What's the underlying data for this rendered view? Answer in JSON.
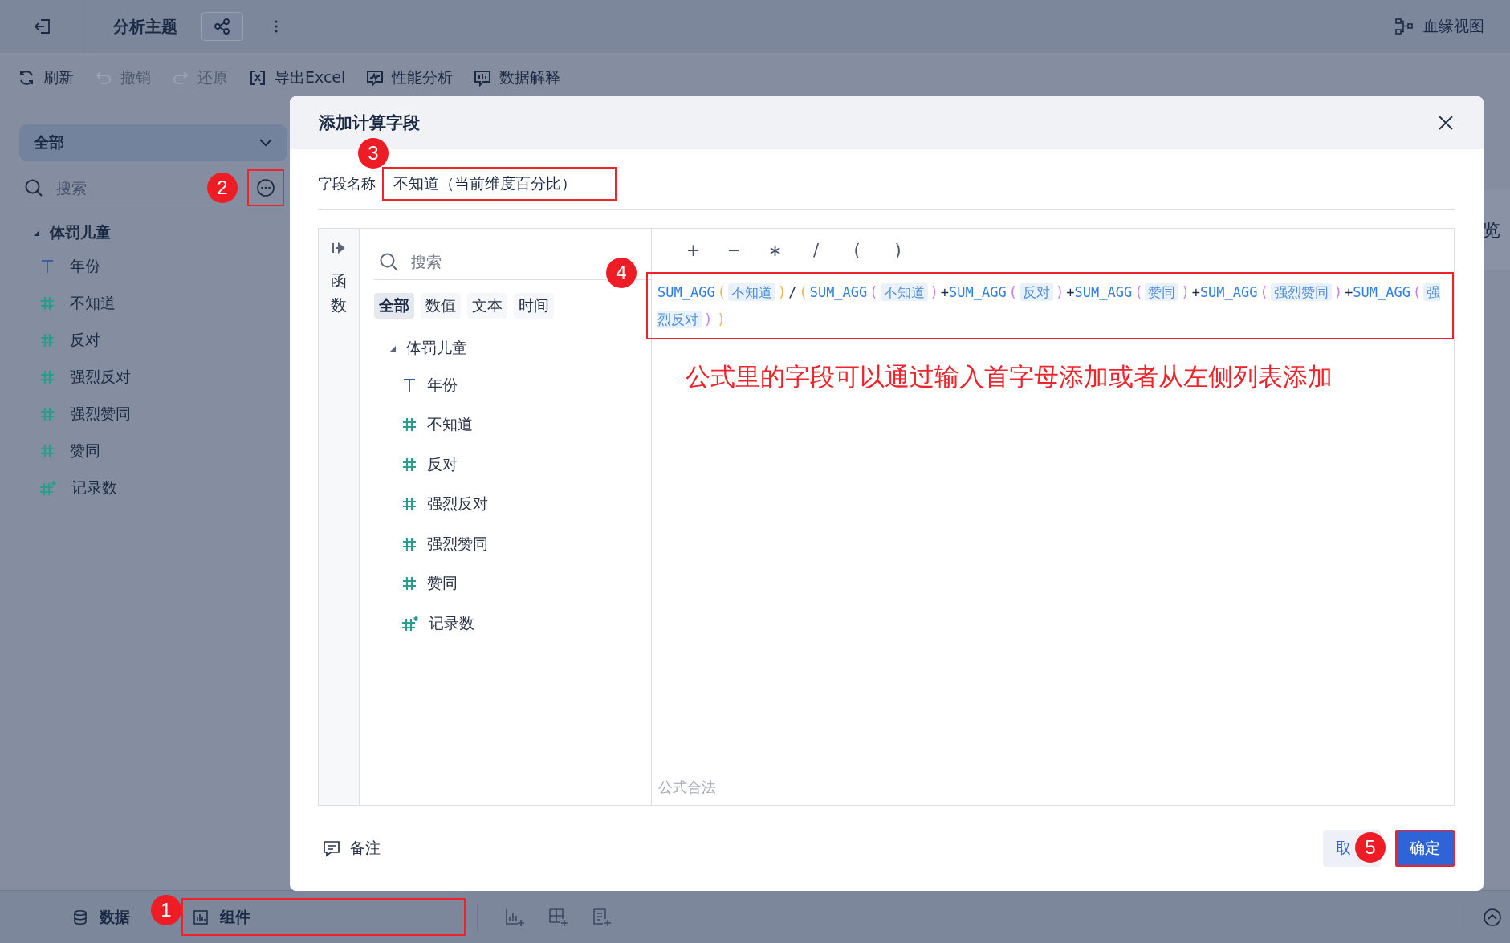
{
  "top_bar": {
    "title": "分析主题",
    "lineage_link": "血缘视图"
  },
  "toolbar": [
    {
      "kind": "refresh",
      "label": "刷新",
      "disabled": false
    },
    {
      "kind": "undo",
      "label": "撤销",
      "disabled": true
    },
    {
      "kind": "redo",
      "label": "还原",
      "disabled": true
    },
    {
      "kind": "excel",
      "label": "导出Excel",
      "disabled": false
    },
    {
      "kind": "performance",
      "label": "性能分析",
      "disabled": false
    },
    {
      "kind": "explain",
      "label": "数据解释",
      "disabled": false
    }
  ],
  "sidebar": {
    "scope_select": "全部",
    "search": {
      "placeholder": "搜索"
    },
    "more_button": {
      "highlighted": true,
      "badge": "2"
    },
    "tree": [
      {
        "label": "体罚儿童",
        "expanded": true,
        "children": [
          {
            "label": "年份",
            "kind": "text"
          },
          {
            "label": "不知道",
            "kind": "number"
          },
          {
            "label": "反对",
            "kind": "number"
          },
          {
            "label": "强烈反对",
            "kind": "number"
          },
          {
            "label": "强烈赞同",
            "kind": "number"
          },
          {
            "label": "赞同",
            "kind": "number"
          },
          {
            "label": "记录数",
            "kind": "count"
          }
        ]
      }
    ]
  },
  "background_panel": {
    "text": "览"
  },
  "dialog": {
    "title": "添加计算字段",
    "name_field": {
      "label": "字段名称",
      "value": "不知道（当前维度百分比）",
      "highlighted": true,
      "badge": "3"
    },
    "side_tab": "函数",
    "field_search": {
      "placeholder": "搜索"
    },
    "filters": [
      {
        "label": "全部",
        "selected": true
      },
      {
        "label": "数值",
        "selected": false
      },
      {
        "label": "文本",
        "selected": false
      },
      {
        "label": "时间",
        "selected": false
      }
    ],
    "field_tree": [
      {
        "label": "体罚儿童",
        "expanded": true,
        "children": [
          {
            "label": "年份",
            "kind": "text"
          },
          {
            "label": "不知道",
            "kind": "number"
          },
          {
            "label": "反对",
            "kind": "number"
          },
          {
            "label": "强烈反对",
            "kind": "number"
          },
          {
            "label": "强烈赞同",
            "kind": "number"
          },
          {
            "label": "赞同",
            "kind": "number"
          },
          {
            "label": "记录数",
            "kind": "count"
          }
        ]
      }
    ],
    "operators": [
      "+",
      "−",
      "∗",
      "/",
      "(",
      ")"
    ],
    "formula": {
      "highlighted": true,
      "badge": "4",
      "tokens": [
        {
          "kind": "func",
          "text": "SUM_AGG"
        },
        {
          "kind": "paren",
          "text": "(",
          "color": "#e8b54c"
        },
        {
          "kind": "field",
          "text": "不知道"
        },
        {
          "kind": "paren",
          "text": ")",
          "color": "#e8b54c"
        },
        {
          "kind": "op",
          "text": "/"
        },
        {
          "kind": "paren",
          "text": "(",
          "color": "#e8b54c"
        },
        {
          "kind": "func",
          "text": "SUM_AGG"
        },
        {
          "kind": "paren",
          "text": "(",
          "color": "#c77ee3"
        },
        {
          "kind": "field",
          "text": "不知道"
        },
        {
          "kind": "paren",
          "text": ")",
          "color": "#c77ee3"
        },
        {
          "kind": "op",
          "text": "+"
        },
        {
          "kind": "func",
          "text": "SUM_AGG"
        },
        {
          "kind": "paren",
          "text": "(",
          "color": "#c77ee3"
        },
        {
          "kind": "field",
          "text": "反对"
        },
        {
          "kind": "paren",
          "text": ")",
          "color": "#c77ee3"
        },
        {
          "kind": "op",
          "text": "+"
        },
        {
          "kind": "func",
          "text": "SUM_AGG"
        },
        {
          "kind": "paren",
          "text": "(",
          "color": "#c77ee3"
        },
        {
          "kind": "field",
          "text": "赞同"
        },
        {
          "kind": "paren",
          "text": ")",
          "color": "#c77ee3"
        },
        {
          "kind": "op",
          "text": "+"
        },
        {
          "kind": "func",
          "text": "SUM_AGG"
        },
        {
          "kind": "paren",
          "text": "(",
          "color": "#c77ee3"
        },
        {
          "kind": "field",
          "text": "强烈赞同"
        },
        {
          "kind": "paren",
          "text": ")",
          "color": "#c77ee3"
        },
        {
          "kind": "op",
          "text": "+"
        },
        {
          "kind": "func",
          "text": "SUM_AGG"
        },
        {
          "kind": "paren",
          "text": "(",
          "color": "#c77ee3"
        },
        {
          "kind": "field",
          "text": "强烈反对"
        },
        {
          "kind": "paren",
          "text": ")",
          "color": "#c77ee3"
        },
        {
          "kind": "paren",
          "text": ")",
          "color": "#e8b54c"
        }
      ]
    },
    "hint": "公式里的字段可以通过输入首字母添加或者从左侧列表添加",
    "status": "公式合法",
    "remark_button": "备注",
    "cancel_button": {
      "label": "取",
      "badge": "5"
    },
    "confirm_button": {
      "label": "确定",
      "highlighted": true
    }
  },
  "bottom_bar": {
    "tabs": [
      {
        "label": "数据",
        "highlighted": false
      },
      {
        "label": "组件",
        "highlighted": true,
        "badge": "1"
      }
    ]
  }
}
